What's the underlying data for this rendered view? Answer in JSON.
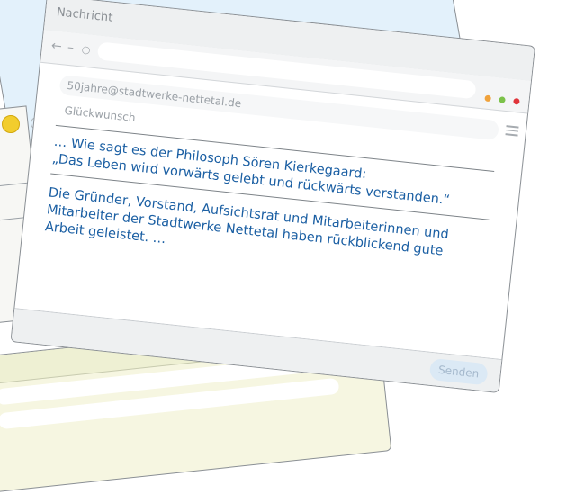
{
  "window": {
    "title": "Nachricht",
    "to_address": "50jahre@stadtwerke-nettetal.de",
    "subject": "Glückwunsch",
    "send_label": "Senden"
  },
  "message": {
    "line1": "… Wie sagt es der Philosoph Sören Kierkegaard:",
    "line2": "„Das Leben wird vorwärts gelebt und rückwärts verstanden.“",
    "para2": "Die Gründer, Vorstand, Aufsichtsrat und Mitarbeiterinnen und Mitarbeiter der Stadtwerke Nettetal haben rückblickend gute Arbeit geleistet. …"
  },
  "nav": {
    "back_icon": "←",
    "forward_icon": "–",
    "refresh_icon": "○"
  },
  "colors": {
    "text_blue": "#1b5fa3",
    "traffic_orange": "#f0a23b",
    "traffic_green": "#7cc24a",
    "traffic_red": "#e0343a"
  }
}
